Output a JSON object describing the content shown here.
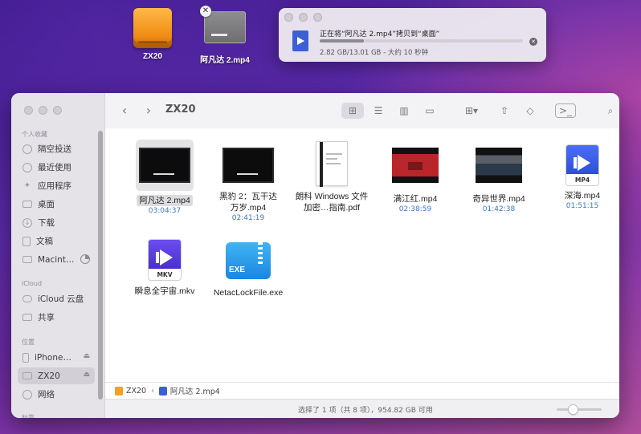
{
  "desktop": {
    "items": [
      {
        "label": "ZX20",
        "icon": "external-drive-icon"
      },
      {
        "label": "阿凡达 2.mp4",
        "icon": "video-file-icon"
      }
    ]
  },
  "copy_dialog": {
    "title": "正在将“阿凡达 2.mp4”拷贝到“桌面”",
    "progress": "2.82 GB/13.01 GB - 大约 10 秒钟",
    "progress_fraction": 0.217
  },
  "finder": {
    "title": "ZX20",
    "sidebar": {
      "favorites_header": "个人收藏",
      "favorites": [
        "隔空投送",
        "最近使用",
        "应用程序",
        "桌面",
        "下载",
        "文稿",
        "Macint…"
      ],
      "icloud_header": "iCloud",
      "icloud": [
        "iCloud 云盘",
        "共享"
      ],
      "locations_header": "位置",
      "locations": [
        "iPhone…",
        "ZX20",
        "网络"
      ],
      "tags_header": "标签"
    },
    "files": [
      {
        "name": "阿凡达 2.mp4",
        "meta": "03:04:37"
      },
      {
        "name": "黑豹 2：瓦干达万岁.mp4",
        "meta": "02:41:19"
      },
      {
        "name": "朗科 Windows 文件加密…指南.pdf",
        "meta": ""
      },
      {
        "name": "满江红.mp4",
        "meta": "02:38:59"
      },
      {
        "name": "奇异世界.mp4",
        "meta": "01:42:38"
      },
      {
        "name": "深海.mp4",
        "meta": "01:51:15"
      },
      {
        "name": "瞬息全宇宙.mkv",
        "meta": ""
      },
      {
        "name": "NetacLockFile.exe",
        "meta": ""
      }
    ],
    "thumb_labels": {
      "mp4": "MP4",
      "mkv": "MKV",
      "exe": "EXE"
    },
    "path": [
      "ZX20",
      "阿凡达 2.mp4"
    ],
    "status": "选择了 1 项（共 8 项），954.82 GB 可用",
    "zoom_level": 0.36
  },
  "colors": {
    "accent": "#3a78c7",
    "desktop_top": "#3a1a8a",
    "desktop_bottom": "#b04e9c"
  }
}
